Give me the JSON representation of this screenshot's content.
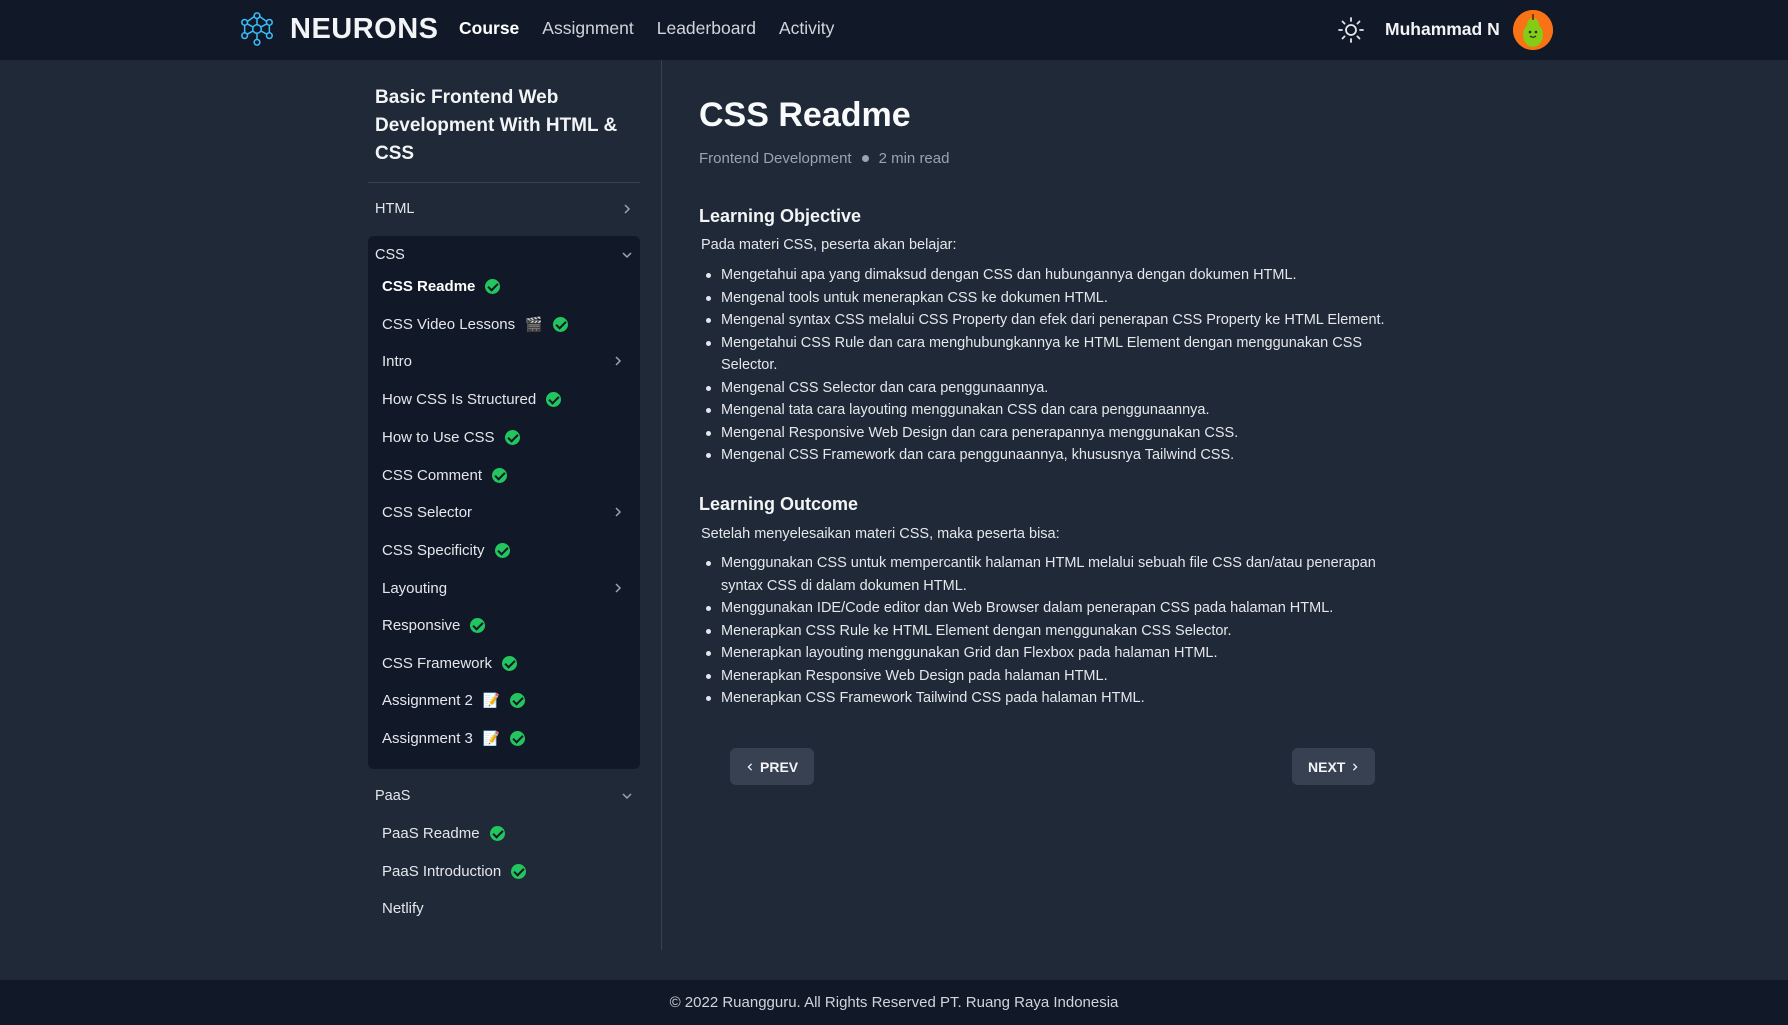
{
  "header": {
    "brand": "NEURONS",
    "nav": [
      {
        "label": "Course",
        "active": true
      },
      {
        "label": "Assignment",
        "active": false
      },
      {
        "label": "Leaderboard",
        "active": false
      },
      {
        "label": "Activity",
        "active": false
      }
    ],
    "user_name": "Muhammad N",
    "icons": {
      "logo": "neuron-network-icon",
      "theme": "sun-icon",
      "avatar": "pear-avatar"
    }
  },
  "sidebar": {
    "course_title": "Basic Frontend Web Development With HTML & CSS",
    "sections": {
      "html": {
        "label": "HTML",
        "expanded": false
      },
      "css": {
        "label": "CSS",
        "expanded": true,
        "items": [
          {
            "label": "CSS Readme",
            "done": true,
            "current": true
          },
          {
            "label": "CSS Video Lessons",
            "emoji": "🎬",
            "done": true
          },
          {
            "label": "Intro",
            "submenu": true
          },
          {
            "label": "How CSS Is Structured",
            "done": true
          },
          {
            "label": "How to Use CSS",
            "done": true
          },
          {
            "label": "CSS Comment",
            "done": true
          },
          {
            "label": "CSS Selector",
            "submenu": true
          },
          {
            "label": "CSS Specificity",
            "done": true
          },
          {
            "label": "Layouting",
            "submenu": true
          },
          {
            "label": "Responsive",
            "done": true
          },
          {
            "label": "CSS Framework",
            "done": true
          },
          {
            "label": "Assignment 2",
            "emoji": "📝",
            "done": true
          },
          {
            "label": "Assignment 3",
            "emoji": "📝",
            "done": true
          }
        ]
      },
      "paas": {
        "label": "PaaS",
        "expanded": true,
        "items": [
          {
            "label": "PaaS Readme",
            "done": true
          },
          {
            "label": "PaaS Introduction",
            "done": true
          },
          {
            "label": "Netlify",
            "done": false
          }
        ]
      }
    },
    "colors": {
      "check": "#22c55e",
      "active_bg": "#111827"
    }
  },
  "content": {
    "title": "CSS Readme",
    "category": "Frontend Development",
    "read_time": "2 min read",
    "objective": {
      "heading": "Learning Objective",
      "intro": "Pada materi CSS, peserta akan belajar:",
      "items": [
        "Mengetahui apa yang dimaksud dengan CSS dan hubungannya dengan dokumen HTML.",
        "Mengenal tools untuk menerapkan CSS ke dokumen HTML.",
        "Mengenal syntax CSS melalui CSS Property dan efek dari penerapan CSS Property ke HTML Element.",
        "Mengetahui CSS Rule dan cara menghubungkannya ke HTML Element dengan menggunakan CSS Selector.",
        "Mengenal CSS Selector dan cara penggunaannya.",
        "Mengenal tata cara layouting menggunakan CSS dan cara penggunaannya.",
        "Mengenal Responsive Web Design dan cara penerapannya menggunakan CSS.",
        "Mengenal CSS Framework dan cara penggunaannya, khususnya Tailwind CSS."
      ]
    },
    "outcome": {
      "heading": "Learning Outcome",
      "intro": "Setelah menyelesaikan materi CSS, maka peserta bisa:",
      "items": [
        "Menggunakan CSS untuk mempercantik halaman HTML melalui sebuah file CSS dan/atau penerapan syntax CSS di dalam dokumen HTML.",
        "Menggunakan IDE/Code editor dan Web Browser dalam penerapan CSS pada halaman HTML.",
        "Menerapkan CSS Rule ke HTML Element dengan menggunakan CSS Selector.",
        "Menerapkan layouting menggunakan Grid dan Flexbox pada halaman HTML.",
        "Menerapkan Responsive Web Design pada halaman HTML.",
        "Menerapkan CSS Framework Tailwind CSS pada halaman HTML."
      ]
    },
    "prev_label": "PREV",
    "next_label": "NEXT"
  },
  "footer": {
    "text": "© 2022 Ruangguru. All Rights Reserved PT. Ruang Raya Indonesia"
  }
}
